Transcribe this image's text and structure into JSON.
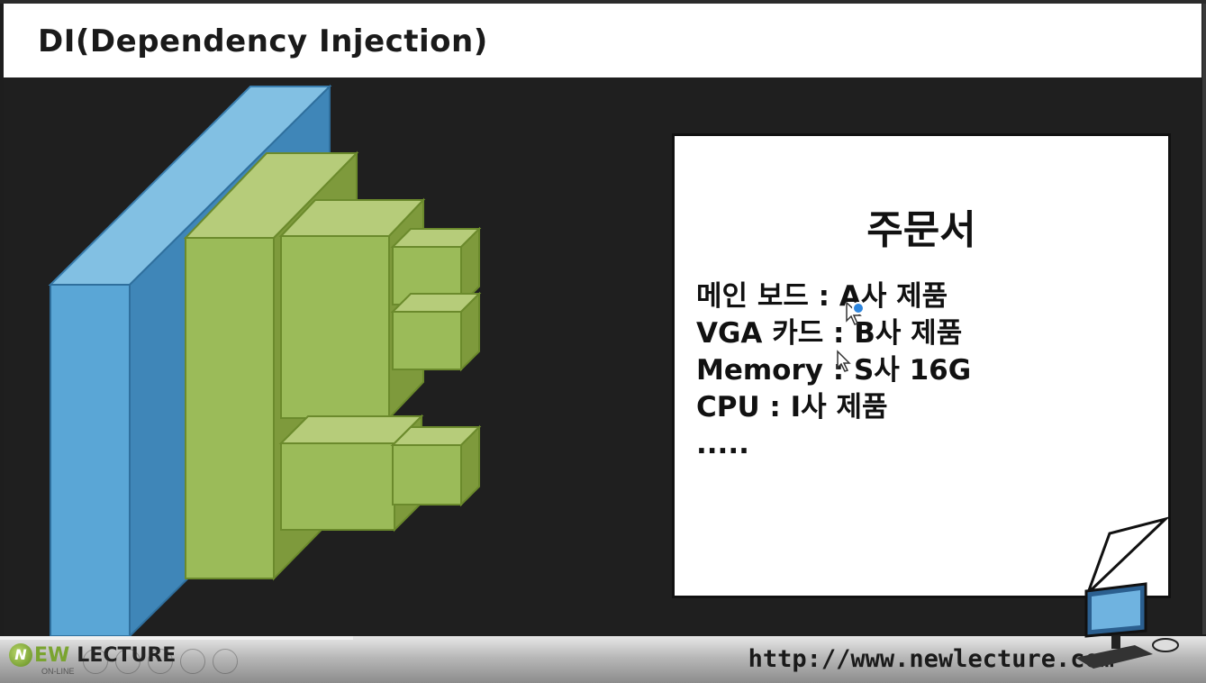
{
  "slide": {
    "title": "DI(Dependency Injection)"
  },
  "order_sheet": {
    "title": "주문서",
    "lines": [
      "메인 보드 : A사 제품",
      "VGA 카드 : B사 제품",
      "Memory  : S사 16G",
      "CPU : I사 제품",
      "....."
    ]
  },
  "footer": {
    "logo_letter": "N",
    "brand_ew": "EW",
    "brand_lecture": "LECTURE",
    "brand_sub": "ON-LINE",
    "url": "http://www.newlecture.com"
  },
  "colors": {
    "board_blue": "#5aa6d6",
    "component_green": "#9bbb59",
    "slide_background": "#1f1f1f"
  },
  "icons": [
    "mouse-cursor-icon",
    "monitor-icon"
  ]
}
